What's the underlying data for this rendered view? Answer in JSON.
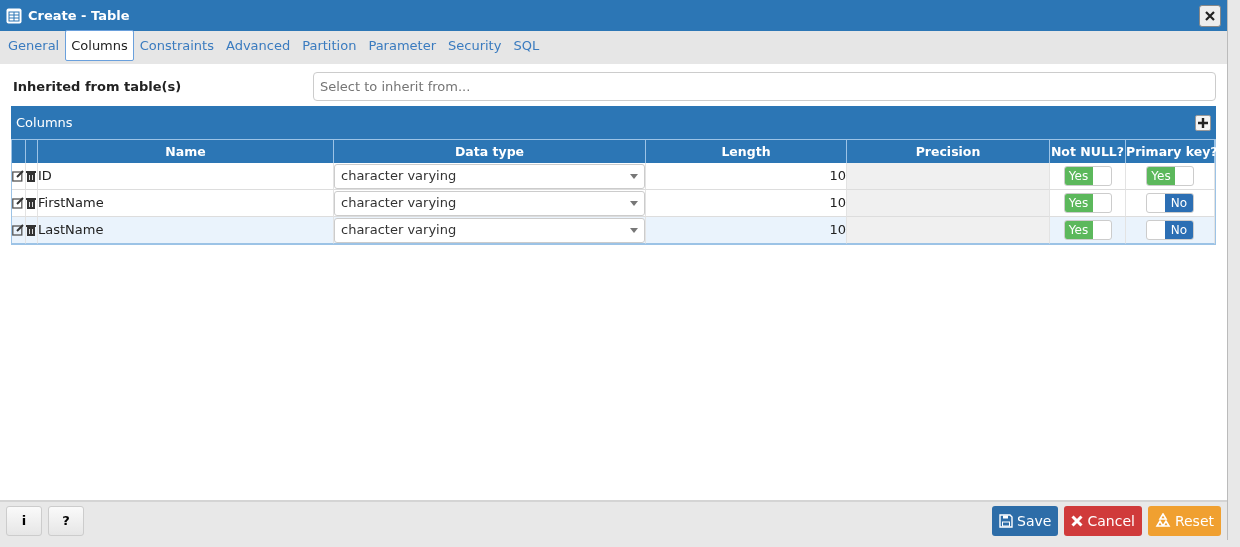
{
  "window": {
    "title": "Create - Table"
  },
  "tabs": [
    {
      "label": "General",
      "selected": false
    },
    {
      "label": "Columns",
      "selected": true
    },
    {
      "label": "Constraints",
      "selected": false
    },
    {
      "label": "Advanced",
      "selected": false
    },
    {
      "label": "Partition",
      "selected": false
    },
    {
      "label": "Parameter",
      "selected": false
    },
    {
      "label": "Security",
      "selected": false
    },
    {
      "label": "SQL",
      "selected": false
    }
  ],
  "inherit": {
    "label": "Inherited from table(s)",
    "placeholder": "Select to inherit from..."
  },
  "columns_panel": {
    "title": "Columns",
    "headers": [
      "Name",
      "Data type",
      "Length",
      "Precision",
      "Not NULL?",
      "Primary key?"
    ],
    "rows": [
      {
        "name": "ID",
        "data_type": "character varying",
        "length": "10",
        "not_null": true,
        "not_null_label": "Yes",
        "primary_key": true,
        "primary_key_label": "Yes",
        "selected": false
      },
      {
        "name": "FirstName",
        "data_type": "character varying",
        "length": "10",
        "not_null": true,
        "not_null_label": "Yes",
        "primary_key": false,
        "primary_key_label": "No",
        "selected": false
      },
      {
        "name": "LastName",
        "data_type": "character varying",
        "length": "10",
        "not_null": true,
        "not_null_label": "Yes",
        "primary_key": false,
        "primary_key_label": "No",
        "selected": true
      }
    ]
  },
  "footer": {
    "left_buttons": [
      "i",
      "?"
    ],
    "right_buttons": [
      {
        "kind": "save",
        "label": "Save"
      },
      {
        "kind": "cancel",
        "label": "Cancel"
      },
      {
        "kind": "reset",
        "label": "Reset"
      }
    ]
  }
}
